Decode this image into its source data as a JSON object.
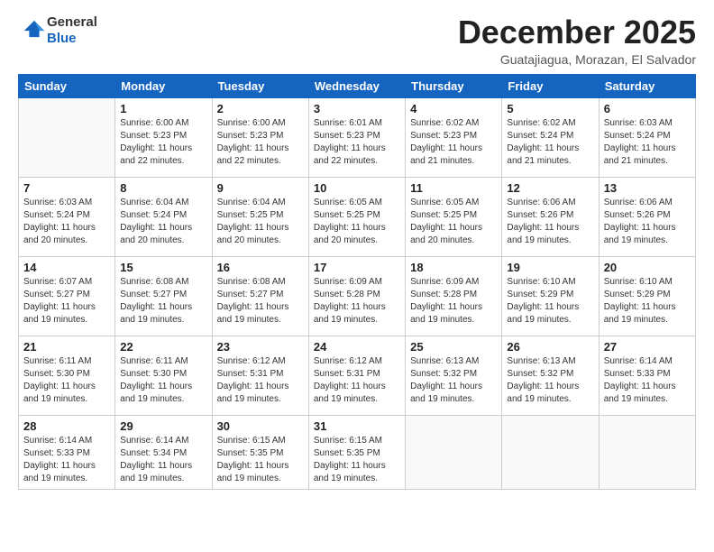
{
  "logo": {
    "general": "General",
    "blue": "Blue"
  },
  "title": "December 2025",
  "subtitle": "Guatajiagua, Morazan, El Salvador",
  "weekdays": [
    "Sunday",
    "Monday",
    "Tuesday",
    "Wednesday",
    "Thursday",
    "Friday",
    "Saturday"
  ],
  "weeks": [
    [
      {
        "day": "",
        "info": ""
      },
      {
        "day": "1",
        "info": "Sunrise: 6:00 AM\nSunset: 5:23 PM\nDaylight: 11 hours\nand 22 minutes."
      },
      {
        "day": "2",
        "info": "Sunrise: 6:00 AM\nSunset: 5:23 PM\nDaylight: 11 hours\nand 22 minutes."
      },
      {
        "day": "3",
        "info": "Sunrise: 6:01 AM\nSunset: 5:23 PM\nDaylight: 11 hours\nand 22 minutes."
      },
      {
        "day": "4",
        "info": "Sunrise: 6:02 AM\nSunset: 5:23 PM\nDaylight: 11 hours\nand 21 minutes."
      },
      {
        "day": "5",
        "info": "Sunrise: 6:02 AM\nSunset: 5:24 PM\nDaylight: 11 hours\nand 21 minutes."
      },
      {
        "day": "6",
        "info": "Sunrise: 6:03 AM\nSunset: 5:24 PM\nDaylight: 11 hours\nand 21 minutes."
      }
    ],
    [
      {
        "day": "7",
        "info": "Sunrise: 6:03 AM\nSunset: 5:24 PM\nDaylight: 11 hours\nand 20 minutes."
      },
      {
        "day": "8",
        "info": "Sunrise: 6:04 AM\nSunset: 5:24 PM\nDaylight: 11 hours\nand 20 minutes."
      },
      {
        "day": "9",
        "info": "Sunrise: 6:04 AM\nSunset: 5:25 PM\nDaylight: 11 hours\nand 20 minutes."
      },
      {
        "day": "10",
        "info": "Sunrise: 6:05 AM\nSunset: 5:25 PM\nDaylight: 11 hours\nand 20 minutes."
      },
      {
        "day": "11",
        "info": "Sunrise: 6:05 AM\nSunset: 5:25 PM\nDaylight: 11 hours\nand 20 minutes."
      },
      {
        "day": "12",
        "info": "Sunrise: 6:06 AM\nSunset: 5:26 PM\nDaylight: 11 hours\nand 19 minutes."
      },
      {
        "day": "13",
        "info": "Sunrise: 6:06 AM\nSunset: 5:26 PM\nDaylight: 11 hours\nand 19 minutes."
      }
    ],
    [
      {
        "day": "14",
        "info": "Sunrise: 6:07 AM\nSunset: 5:27 PM\nDaylight: 11 hours\nand 19 minutes."
      },
      {
        "day": "15",
        "info": "Sunrise: 6:08 AM\nSunset: 5:27 PM\nDaylight: 11 hours\nand 19 minutes."
      },
      {
        "day": "16",
        "info": "Sunrise: 6:08 AM\nSunset: 5:27 PM\nDaylight: 11 hours\nand 19 minutes."
      },
      {
        "day": "17",
        "info": "Sunrise: 6:09 AM\nSunset: 5:28 PM\nDaylight: 11 hours\nand 19 minutes."
      },
      {
        "day": "18",
        "info": "Sunrise: 6:09 AM\nSunset: 5:28 PM\nDaylight: 11 hours\nand 19 minutes."
      },
      {
        "day": "19",
        "info": "Sunrise: 6:10 AM\nSunset: 5:29 PM\nDaylight: 11 hours\nand 19 minutes."
      },
      {
        "day": "20",
        "info": "Sunrise: 6:10 AM\nSunset: 5:29 PM\nDaylight: 11 hours\nand 19 minutes."
      }
    ],
    [
      {
        "day": "21",
        "info": "Sunrise: 6:11 AM\nSunset: 5:30 PM\nDaylight: 11 hours\nand 19 minutes."
      },
      {
        "day": "22",
        "info": "Sunrise: 6:11 AM\nSunset: 5:30 PM\nDaylight: 11 hours\nand 19 minutes."
      },
      {
        "day": "23",
        "info": "Sunrise: 6:12 AM\nSunset: 5:31 PM\nDaylight: 11 hours\nand 19 minutes."
      },
      {
        "day": "24",
        "info": "Sunrise: 6:12 AM\nSunset: 5:31 PM\nDaylight: 11 hours\nand 19 minutes."
      },
      {
        "day": "25",
        "info": "Sunrise: 6:13 AM\nSunset: 5:32 PM\nDaylight: 11 hours\nand 19 minutes."
      },
      {
        "day": "26",
        "info": "Sunrise: 6:13 AM\nSunset: 5:32 PM\nDaylight: 11 hours\nand 19 minutes."
      },
      {
        "day": "27",
        "info": "Sunrise: 6:14 AM\nSunset: 5:33 PM\nDaylight: 11 hours\nand 19 minutes."
      }
    ],
    [
      {
        "day": "28",
        "info": "Sunrise: 6:14 AM\nSunset: 5:33 PM\nDaylight: 11 hours\nand 19 minutes."
      },
      {
        "day": "29",
        "info": "Sunrise: 6:14 AM\nSunset: 5:34 PM\nDaylight: 11 hours\nand 19 minutes."
      },
      {
        "day": "30",
        "info": "Sunrise: 6:15 AM\nSunset: 5:35 PM\nDaylight: 11 hours\nand 19 minutes."
      },
      {
        "day": "31",
        "info": "Sunrise: 6:15 AM\nSunset: 5:35 PM\nDaylight: 11 hours\nand 19 minutes."
      },
      {
        "day": "",
        "info": ""
      },
      {
        "day": "",
        "info": ""
      },
      {
        "day": "",
        "info": ""
      }
    ]
  ]
}
